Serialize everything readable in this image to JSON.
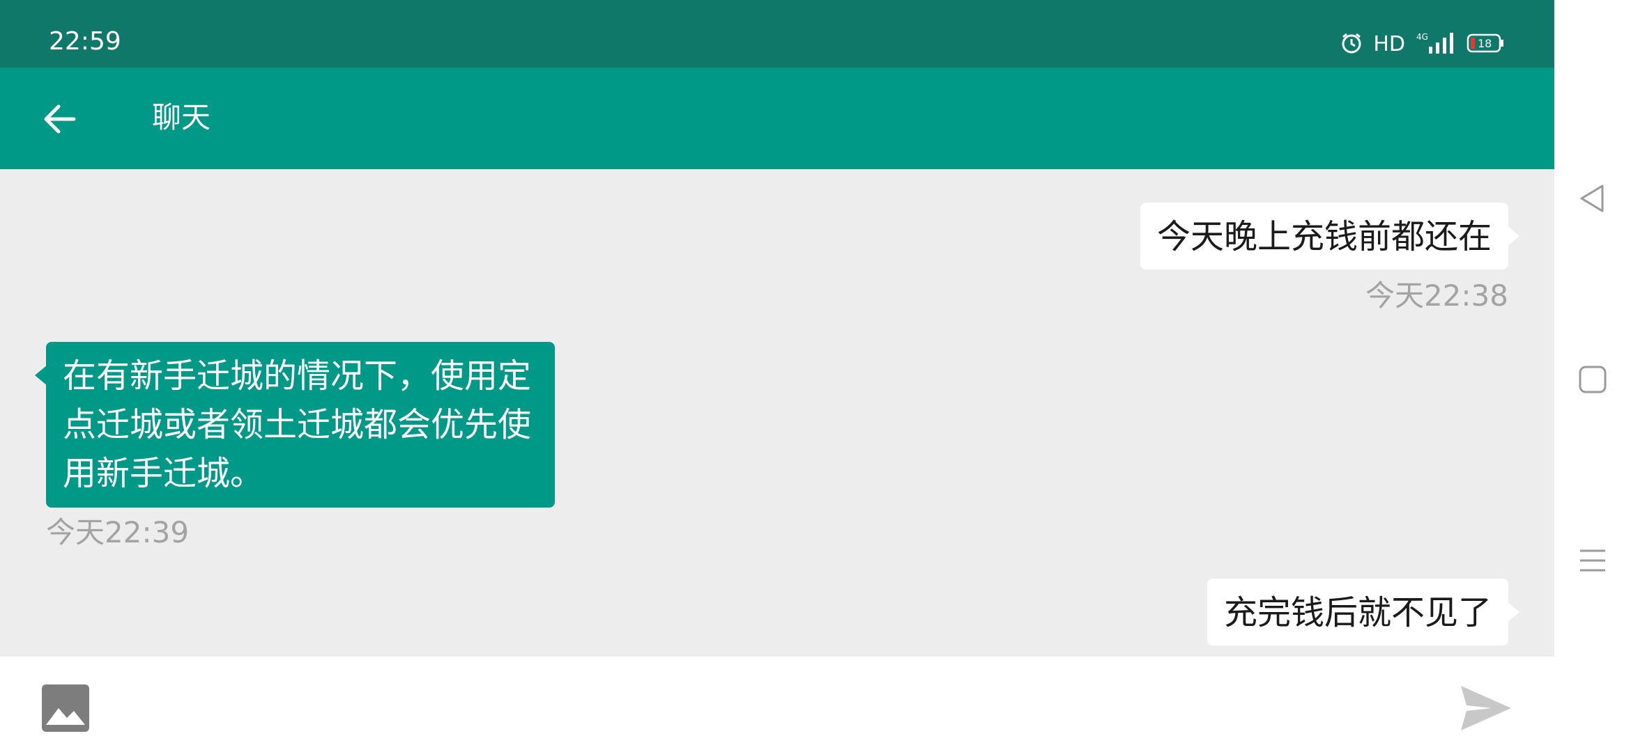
{
  "status_bar": {
    "time": "22:59",
    "network_label": "HD",
    "signal_label": "4G",
    "battery": "18",
    "icons": [
      "alarm-icon",
      "hd-icon",
      "signal-icon",
      "battery-icon"
    ]
  },
  "toolbar": {
    "back_icon": "arrow-left-icon",
    "title": "聊天"
  },
  "messages": [
    {
      "direction": "outgoing",
      "text": "今天晚上充钱前都还在",
      "timestamp": "今天22:38"
    },
    {
      "direction": "incoming",
      "text": "在有新手迁城的情况下，使用定点迁城或者领土迁城都会优先使用新手迁城。",
      "timestamp": "今天22:39"
    },
    {
      "direction": "outgoing",
      "text": "充完钱后就不见了",
      "timestamp": ""
    }
  ],
  "input_bar": {
    "image_icon": "image-icon",
    "send_icon": "send-icon"
  },
  "nav_bar": {
    "icons": [
      "back-triangle-icon",
      "home-square-icon",
      "menu-lines-icon"
    ]
  },
  "colors": {
    "status_bar": "#107868",
    "toolbar": "#009887",
    "chat_background": "#ededed",
    "incoming_bubble": "#009887",
    "outgoing_bubble": "#ffffff",
    "timestamp": "#a3a3a3"
  }
}
